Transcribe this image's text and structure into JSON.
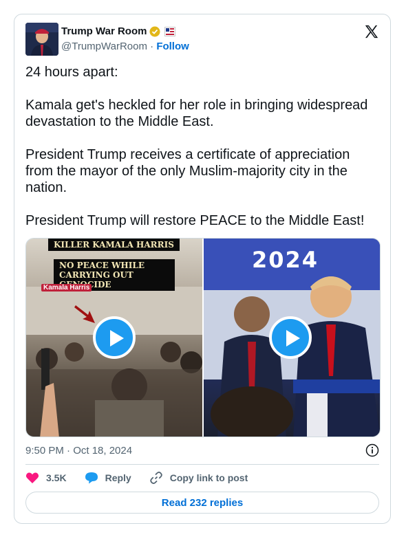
{
  "author": {
    "name": "Trump War Room",
    "handle": "@TrumpWarRoom",
    "separator": "·",
    "follow_label": "Follow"
  },
  "tweet": {
    "paragraphs": [
      "24 hours apart:",
      "Kamala get's heckled for her role in bringing widespread devastation to the Middle East.",
      "President Trump receives a certificate of appreciation from the mayor of the only Muslim-majority city in the nation.",
      "President Trump will restore PEACE to the Middle East!"
    ]
  },
  "media": {
    "left_video": {
      "caption_top": "KILLER KAMALA HARRIS",
      "caption_main": "NO PEACE WHILE CARRYING OUT GENOCIDE",
      "speaker_tag": "Kamala Harris"
    },
    "right_video": {
      "banner_text": "2024"
    }
  },
  "timestamp": "9:50 PM · Oct 18, 2024",
  "actions": {
    "likes": "3.5K",
    "reply": "Reply",
    "copy_link": "Copy link to post"
  },
  "read_replies": "Read 232 replies",
  "colors": {
    "accent": "#1d9bf0",
    "link": "#006fd6",
    "like": "#f91880",
    "muted": "#536471",
    "border": "#cfd9de"
  },
  "icons": [
    "verified-badge-icon",
    "affiliate-flag-icon",
    "x-logo-icon",
    "play-icon",
    "info-icon",
    "heart-icon",
    "reply-bubble-icon",
    "link-icon"
  ]
}
